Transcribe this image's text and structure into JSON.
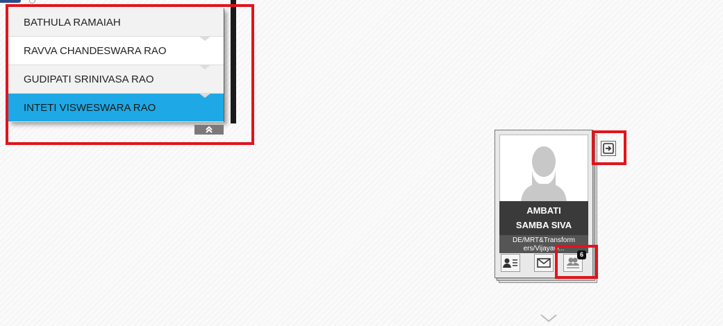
{
  "dropdown": {
    "items": [
      {
        "label": "BATHULA RAMAIAH"
      },
      {
        "label": "RAVVA CHANDESWARA RAO"
      },
      {
        "label": "GUDIPATI SRINIVASA RAO"
      },
      {
        "label": "INTETI VISWESWARA RAO",
        "selected": true
      }
    ],
    "collapse_icon": "double-chevron-up-icon"
  },
  "card": {
    "name_line1": "AMBATI",
    "name_line2": "SAMBA SIVA",
    "designation": "DE/MRT&Transformers/Vijayawada",
    "designation_visible": "DE/MRT&Transform ers/Vijayaw...",
    "team_count": "6",
    "icons": [
      "profile-details-icon",
      "mail-icon",
      "team-icon",
      "exit-icon"
    ]
  },
  "colors": {
    "highlight": "#e3131b",
    "selected_item": "#1ea9e6",
    "name_block": "#3a3a3a"
  }
}
